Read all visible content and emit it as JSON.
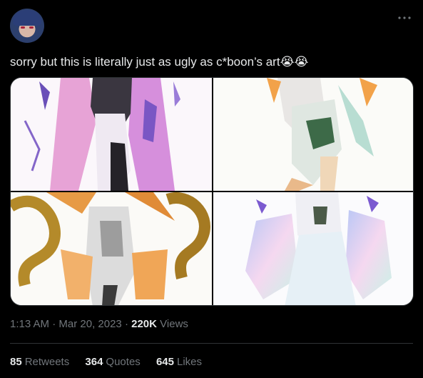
{
  "post": {
    "text": "sorry but this is literally just as ugly as c*boon’s art",
    "emoji_1": "😭",
    "emoji_2": "😭",
    "more_icon": "more-horizontal-icon"
  },
  "media": {
    "images": [
      {
        "name": "image-1"
      },
      {
        "name": "image-2"
      },
      {
        "name": "image-3"
      },
      {
        "name": "image-4"
      }
    ]
  },
  "meta": {
    "time": "1:13 AM",
    "sep1": "·",
    "date": "Mar 20, 2023",
    "sep2": "·",
    "views_count": "220K",
    "views_label": "Views"
  },
  "stats": {
    "retweets_count": "85",
    "retweets_label": "Retweets",
    "quotes_count": "364",
    "quotes_label": "Quotes",
    "likes_count": "645",
    "likes_label": "Likes"
  },
  "colors": {
    "background": "#000000",
    "text": "#e7e9ea",
    "secondary": "#71767b",
    "border": "#2f3336"
  }
}
